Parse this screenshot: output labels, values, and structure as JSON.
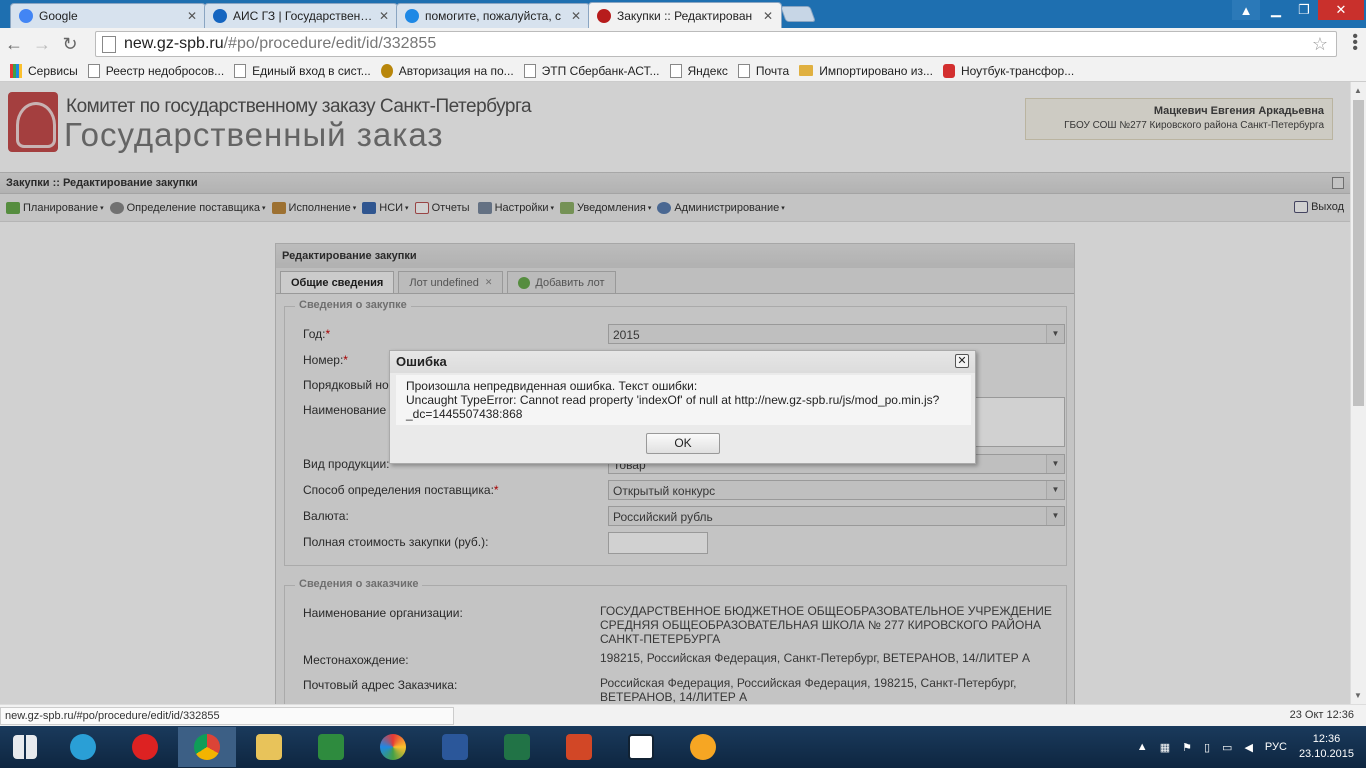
{
  "browser": {
    "tabs": [
      {
        "title": "Google",
        "color": "#4285f4"
      },
      {
        "title": "АИС ГЗ | Государственны",
        "color": "#1565c0"
      },
      {
        "title": "помогите, пожалуйста, с",
        "color": "#1e88e5"
      },
      {
        "title": "Закупки :: Редактирован",
        "color": "#b71c1c"
      }
    ],
    "url_host": "new.gz-spb.ru",
    "url_path": "/#po/procedure/edit/id/332855",
    "bookmarks": [
      {
        "label": "Сервисы",
        "icon": "apps-grid-icon"
      },
      {
        "label": "Реестр недобросов...",
        "icon": "page-icon"
      },
      {
        "label": "Единый вход в сист...",
        "icon": "page-icon"
      },
      {
        "label": "Авторизация на по...",
        "icon": "emblem-icon"
      },
      {
        "label": "ЭТП Сбербанк-АСТ...",
        "icon": "page-icon"
      },
      {
        "label": "Яндекс",
        "icon": "page-icon"
      },
      {
        "label": "Почта",
        "icon": "page-icon"
      },
      {
        "label": "Импортировано из...",
        "icon": "folder-icon"
      },
      {
        "label": "Ноутбук-трансфор...",
        "icon": "io-icon"
      }
    ]
  },
  "site": {
    "subtitle": "Комитет по государственному заказу Санкт-Петербурга",
    "title": "Государственный заказ",
    "user_name": "Мацкевич Евгения Аркадьевна",
    "user_org": "ГБОУ СОШ №277 Кировского района Санкт-Петербурга"
  },
  "mainbar": {
    "title": "Закупки :: Редактирование закупки"
  },
  "menu": [
    {
      "label": "Планирование",
      "arrow": "▾"
    },
    {
      "label": "Определение поставщика",
      "arrow": "▾"
    },
    {
      "label": "Исполнение",
      "arrow": "▾"
    },
    {
      "label": "НСИ",
      "arrow": "▾"
    },
    {
      "label": "Отчеты",
      "arrow": ""
    },
    {
      "label": "Настройки",
      "arrow": "▾"
    },
    {
      "label": "Уведомления",
      "arrow": "▾"
    },
    {
      "label": "Администрирование",
      "arrow": "▾"
    }
  ],
  "exit_label": "Выход",
  "panel": {
    "title": "Редактирование закупки",
    "tabs": [
      "Общие сведения",
      "Лот undefined",
      "Добавить лот"
    ]
  },
  "procurement": {
    "legend": "Сведения о закупке",
    "year_label": "Год:",
    "year_value": "2015",
    "number_label": "Номер:",
    "ordinal_label": "Порядковый ном",
    "name_label": "Наименование за",
    "product_label": "Вид продукции:",
    "product_value": "Товар",
    "method_label": "Способ определения поставщика:",
    "method_value": "Открытый конкурс",
    "currency_label": "Валюта:",
    "currency_value": "Российский рубль",
    "cost_label": "Полная стоимость закупки (руб.):"
  },
  "customer": {
    "legend": "Сведения о заказчике",
    "org_label": "Наименование организации:",
    "org_value": "ГОСУДАРСТВЕННОЕ БЮДЖЕТНОЕ ОБЩЕОБРАЗОВАТЕЛЬНОЕ УЧРЕЖДЕНИЕ СРЕДНЯЯ ОБЩЕОБРАЗОВАТЕЛЬНАЯ ШКОЛА № 277 КИРОВСКОГО РАЙОНА САНКТ-ПЕТЕРБУРГА",
    "loc_label": "Местонахождение:",
    "loc_value": "198215, Российская Федерация, Санкт-Петербург, ВЕТЕРАНОВ, 14/ЛИТЕР А",
    "post_label": "Почтовый адрес Заказчика:",
    "post_value": "Российская Федерация, Российская Федерация, 198215, Санкт-Петербург, ВЕТЕРАНОВ, 14/ЛИТЕР А"
  },
  "dialog": {
    "title": "Ошибка",
    "line1": "Произошла непредвиденная ошибка. Текст ошибки:",
    "line2": "Uncaught TypeError: Cannot read property 'indexOf' of null at http://new.gz-spb.ru/js/mod_po.min.js?",
    "line3": "_dc=1445507438:868",
    "ok": "OK"
  },
  "status": {
    "url": "new.gz-spb.ru/#po/procedure/edit/id/332855",
    "datetime": "23 Окт 12:36"
  },
  "taskbar": {
    "lang": "РУС",
    "time": "12:36",
    "date": "23.10.2015"
  }
}
